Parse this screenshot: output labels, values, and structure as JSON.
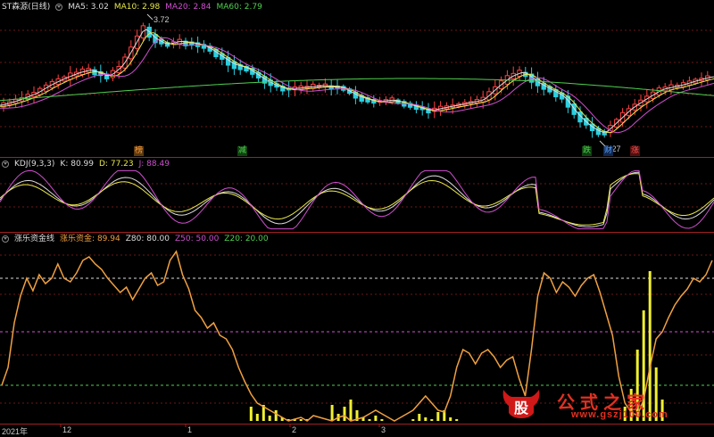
{
  "main_panel": {
    "stock_name": "ST森源(日线)",
    "legend": [
      {
        "label": "MA5:",
        "value": "3.02",
        "color": "#dddddd"
      },
      {
        "label": "MA10:",
        "value": "2.98",
        "color": "#e8e84a"
      },
      {
        "label": "MA20:",
        "value": "2.84",
        "color": "#d04fd0"
      },
      {
        "label": "MA60:",
        "value": "2.79",
        "color": "#4fd04f"
      }
    ],
    "price_high_label": "3.72",
    "price_low_label": "2.27",
    "signals": [
      {
        "text": "榜",
        "color": "#ff9a3a"
      },
      {
        "text": "减",
        "color": "#4fd04f"
      },
      {
        "text": "跌",
        "color": "#4fd04f"
      },
      {
        "text": "财",
        "color": "#5aa0ff"
      },
      {
        "text": "涨",
        "color": "#ff5050"
      }
    ]
  },
  "kdj_panel": {
    "title": "KDJ(9,3,3)",
    "k_label": "K:",
    "k_value": "80.99",
    "d_label": "D:",
    "d_value": "77.23",
    "j_label": "J:",
    "j_value": "88.49"
  },
  "fund_panel": {
    "title": "涨乐资金线",
    "l1_label": "涨乐资金:",
    "l1_value": "89.94",
    "l2_label": "Z80:",
    "l2_value": "80.00",
    "l3_label": "Z50:",
    "l3_value": "50.00",
    "l4_label": "Z20:",
    "l4_value": "20.00"
  },
  "x_axis": {
    "labels": [
      "2021年",
      "12",
      "1",
      "2",
      "3"
    ]
  },
  "watermark": {
    "logo_char": "股",
    "text": "公式之家",
    "url": "www.gszj100.com"
  },
  "chart_data": [
    {
      "type": "candlestick",
      "title": "ST森源(日线)",
      "high_marker": 3.72,
      "low_marker": 2.27,
      "series": [
        {
          "name": "MA5",
          "last": 3.02
        },
        {
          "name": "MA10",
          "last": 2.98
        },
        {
          "name": "MA20",
          "last": 2.84
        },
        {
          "name": "MA60",
          "last": 2.79
        }
      ],
      "x_axis_labels": [
        "2021年",
        "12",
        "1",
        "2",
        "3"
      ]
    },
    {
      "type": "line",
      "title": "KDJ(9,3,3)",
      "ylim": [
        0,
        100
      ],
      "series": [
        {
          "name": "K",
          "last": 80.99
        },
        {
          "name": "D",
          "last": 77.23
        },
        {
          "name": "J",
          "last": 88.49
        }
      ]
    },
    {
      "type": "line",
      "title": "涨乐资金线",
      "ylim": [
        0,
        100
      ],
      "series": [
        {
          "name": "涨乐资金",
          "last": 89.94,
          "values": [
            20,
            30,
            55,
            70,
            80,
            73,
            82,
            77,
            80,
            88,
            80,
            78,
            83,
            90,
            92,
            88,
            85,
            80,
            76,
            72,
            75,
            68,
            74,
            80,
            83,
            76,
            78,
            90,
            95,
            82,
            74,
            62,
            58,
            52,
            55,
            48,
            46,
            40,
            30,
            22,
            15,
            10,
            8,
            6,
            4,
            2,
            0,
            1,
            2,
            0,
            3,
            2,
            1,
            0,
            2,
            3,
            0,
            1,
            2,
            4,
            6,
            4,
            2,
            0,
            2,
            4,
            6,
            10,
            14,
            10,
            6,
            5,
            14,
            30,
            40,
            38,
            32,
            38,
            40,
            36,
            30,
            34,
            36,
            24,
            14,
            40,
            70,
            83,
            80,
            72,
            78,
            75,
            70,
            76,
            80,
            82,
            72,
            60,
            48,
            25,
            10,
            5,
            3,
            12,
            30,
            46,
            50,
            58,
            65,
            70,
            74,
            80,
            78,
            82,
            90
          ]
        },
        {
          "name": "Z80",
          "values": [
            80
          ]
        },
        {
          "name": "Z50",
          "values": [
            50
          ]
        },
        {
          "name": "Z20",
          "values": [
            20
          ]
        }
      ],
      "bars": [
        0,
        0,
        0,
        0,
        0,
        0,
        0,
        0,
        0,
        0,
        0,
        0,
        0,
        0,
        0,
        0,
        0,
        0,
        0,
        0,
        0,
        0,
        0,
        0,
        0,
        0,
        0,
        0,
        0,
        0,
        0,
        0,
        0,
        0,
        0,
        0,
        0,
        0,
        0,
        0,
        8,
        4,
        9,
        3,
        6,
        2,
        1,
        1,
        1,
        1,
        0,
        0,
        0,
        9,
        4,
        8,
        12,
        6,
        2,
        1,
        3,
        1,
        0,
        0,
        0,
        0,
        1,
        4,
        2,
        1,
        5,
        6,
        2,
        1,
        0,
        0,
        0,
        0,
        0,
        0,
        0,
        0,
        0,
        0,
        0,
        0,
        0,
        0,
        0,
        0,
        0,
        0,
        0,
        0,
        0,
        0,
        0,
        0,
        0,
        0,
        8,
        18,
        40,
        62,
        84,
        30,
        12,
        0,
        0,
        0,
        0,
        0,
        0,
        0,
        0,
        0
      ]
    }
  ]
}
